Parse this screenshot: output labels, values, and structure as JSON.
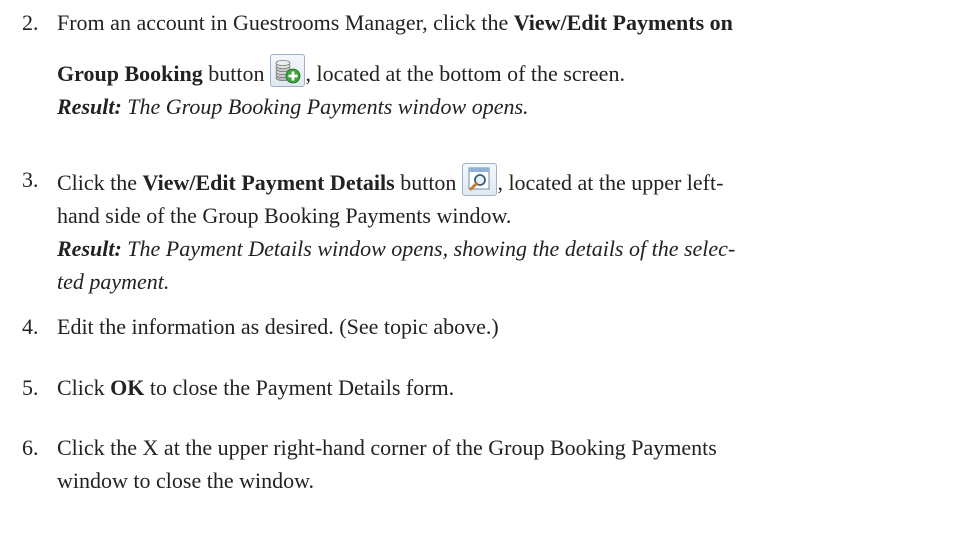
{
  "steps": [
    {
      "number": "2.",
      "lines": [
        {
          "t1": "From an account in Guestrooms Manager, click the ",
          "b1": "View/Edit Payments on"
        },
        {
          "b1": "Group Booking",
          "t1": " button",
          "icon": "coins-add-icon",
          "t2": ", located at the bottom of the screen."
        },
        {
          "rb": "Result:",
          "ri": " The Group Booking Payments window opens."
        }
      ]
    },
    {
      "number": "3.",
      "lines": [
        {
          "t1": "Click the ",
          "b1": "View/Edit Payment Details",
          "t2": " button",
          "icon": "view-details-icon",
          "t3": ", located at the upper left-"
        },
        {
          "t1": "hand side of the Group Booking Payments window."
        },
        {
          "rb": "Result:",
          "ri": " The Payment Details window opens, showing the details of the selec-"
        },
        {
          "ri": "ted payment."
        }
      ]
    },
    {
      "number": "4.",
      "text": "Edit the information as desired. (See topic above.)"
    },
    {
      "number": "5.",
      "pre": "Click ",
      "bold": "OK",
      "post": " to close the Payment Details form."
    },
    {
      "number": "6.",
      "lines": [
        {
          "t1": "Click the X at the upper right-hand corner of the Group Booking Payments"
        },
        {
          "t1": "window to close the window."
        }
      ]
    }
  ]
}
